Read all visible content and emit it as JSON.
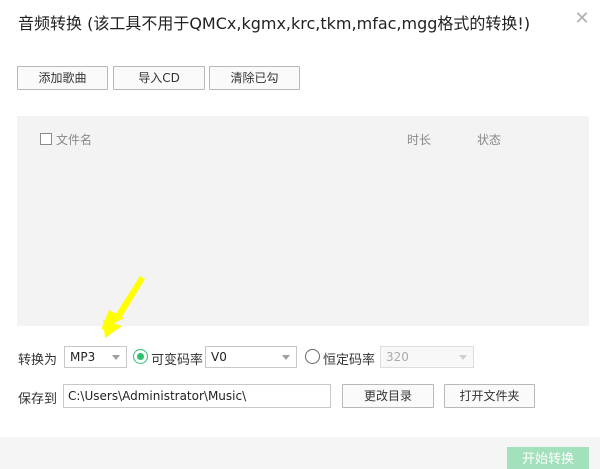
{
  "window": {
    "title": "音频转换 (该工具不用于QMCx,kgmx,krc,tkm,mfac,mgg格式的转换!)",
    "close_label": "✕"
  },
  "toolbar": {
    "add_song_label": "添加歌曲",
    "import_cd_label": "导入CD",
    "clear_checked_label": "清除已勾"
  },
  "file_list": {
    "columns": {
      "name": "文件名",
      "duration": "时长",
      "status": "状态"
    }
  },
  "convert": {
    "label": "转换为",
    "format_value": "MP3",
    "vbr_label": "可变码率",
    "vbr_value": "V0",
    "cbr_label": "恒定码率",
    "cbr_value": "320"
  },
  "save": {
    "label": "保存到",
    "path_value": "C:\\Users\\Administrator\\Music\\",
    "change_dir_label": "更改目录",
    "open_folder_label": "打开文件夹"
  },
  "footer": {
    "start_label": "开始转换"
  },
  "colors": {
    "accent": "#2fbf71",
    "start_button_disabled": "#a3e0bc",
    "annotation_arrow": "#ffff00"
  }
}
